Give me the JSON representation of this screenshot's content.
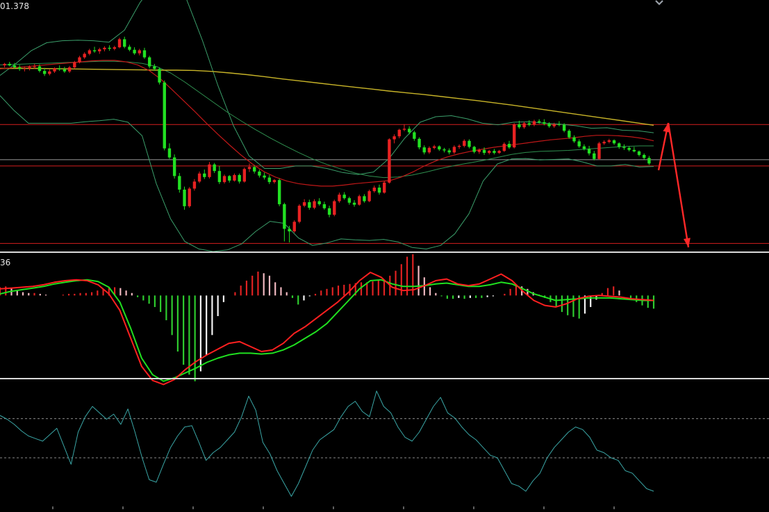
{
  "price_label": "01.378",
  "macd_label": "36",
  "colors": {
    "background": "#000000",
    "bull": "#e82222",
    "bear": "#22e022",
    "level_line": "#d41e1e",
    "gray_line": "#9a9a9a",
    "ma_red": "#c01818",
    "ma_yellow": "#c8b428",
    "ma_green": "#2f8f4f",
    "band": "#3b9f6b",
    "arrow": "#ff2828",
    "macd_fast": "#ff2020",
    "macd_slow": "#20e020",
    "osc_line": "#3aa6a6"
  },
  "chart_data": [
    {
      "type": "candlestick",
      "panel": "price",
      "ylim": [
        0,
        100
      ],
      "up_color": "bull",
      "down_color": "bear",
      "ohlc": [
        [
          74.0,
          75.0,
          73.2,
          74.6
        ],
        [
          74.6,
          75.4,
          73.6,
          74.0
        ],
        [
          74.0,
          75.0,
          72.6,
          73.2
        ],
        [
          73.2,
          74.2,
          71.8,
          72.6
        ],
        [
          72.6,
          73.6,
          71.6,
          72.8
        ],
        [
          72.8,
          74.0,
          72.0,
          73.4
        ],
        [
          73.4,
          74.6,
          72.6,
          73.6
        ],
        [
          73.6,
          74.4,
          71.2,
          71.8
        ],
        [
          71.8,
          73.0,
          69.8,
          70.6
        ],
        [
          70.6,
          72.4,
          70.0,
          71.6
        ],
        [
          71.6,
          73.2,
          71.0,
          72.8
        ],
        [
          72.8,
          74.0,
          71.8,
          72.4
        ],
        [
          72.4,
          73.4,
          71.0,
          71.6
        ],
        [
          71.6,
          73.8,
          71.0,
          73.2
        ],
        [
          73.2,
          75.8,
          72.6,
          75.2
        ],
        [
          75.2,
          77.8,
          74.8,
          77.2
        ],
        [
          77.2,
          79.2,
          76.6,
          78.6
        ],
        [
          78.6,
          80.6,
          78.0,
          80.0
        ],
        [
          80.0,
          81.4,
          79.0,
          79.6
        ],
        [
          79.6,
          81.0,
          78.6,
          80.4
        ],
        [
          80.4,
          81.6,
          79.6,
          81.0
        ],
        [
          81.0,
          82.0,
          79.8,
          80.6
        ],
        [
          80.6,
          81.8,
          80.0,
          81.2
        ],
        [
          81.2,
          85.0,
          80.8,
          84.4
        ],
        [
          84.4,
          85.4,
          80.8,
          81.4
        ],
        [
          81.4,
          82.2,
          79.6,
          80.2
        ],
        [
          80.2,
          81.2,
          78.2,
          78.8
        ],
        [
          78.8,
          80.6,
          78.0,
          80.0
        ],
        [
          80.0,
          81.0,
          76.6,
          77.2
        ],
        [
          77.2,
          77.8,
          72.8,
          73.6
        ],
        [
          73.6,
          74.6,
          71.8,
          72.6
        ],
        [
          72.6,
          73.2,
          66.4,
          67.2
        ],
        [
          67.2,
          68.0,
          40.2,
          41.0
        ],
        [
          41.0,
          43.0,
          36.8,
          37.4
        ],
        [
          37.4,
          38.6,
          29.0,
          30.0
        ],
        [
          30.0,
          31.2,
          23.4,
          24.6
        ],
        [
          24.6,
          25.8,
          16.6,
          18.0
        ],
        [
          18.0,
          25.6,
          17.4,
          25.0
        ],
        [
          25.0,
          28.8,
          24.2,
          27.8
        ],
        [
          27.8,
          31.8,
          27.2,
          31.0
        ],
        [
          31.0,
          32.6,
          28.8,
          29.6
        ],
        [
          29.6,
          35.6,
          29.0,
          34.6
        ],
        [
          34.6,
          35.2,
          31.2,
          32.0
        ],
        [
          32.0,
          34.0,
          26.8,
          27.6
        ],
        [
          27.6,
          30.6,
          27.0,
          30.0
        ],
        [
          30.0,
          30.4,
          27.4,
          28.2
        ],
        [
          28.2,
          31.0,
          27.8,
          30.4
        ],
        [
          30.4,
          31.0,
          27.0,
          27.8
        ],
        [
          27.8,
          33.4,
          27.4,
          32.8
        ],
        [
          32.8,
          35.0,
          31.6,
          33.6
        ],
        [
          33.6,
          34.2,
          31.0,
          31.8
        ],
        [
          31.8,
          32.6,
          29.4,
          30.2
        ],
        [
          30.2,
          31.4,
          28.6,
          29.4
        ],
        [
          29.4,
          30.4,
          26.8,
          27.6
        ],
        [
          27.6,
          28.8,
          27.0,
          28.4
        ],
        [
          28.4,
          29.0,
          18.0,
          18.8
        ],
        [
          18.8,
          19.4,
          4.0,
          9.0
        ],
        [
          9.0,
          10.2,
          3.6,
          8.0
        ],
        [
          8.0,
          12.4,
          7.4,
          11.8
        ],
        [
          11.8,
          18.8,
          11.2,
          18.2
        ],
        [
          18.2,
          20.8,
          17.6,
          19.6
        ],
        [
          19.6,
          20.6,
          16.6,
          17.4
        ],
        [
          17.4,
          20.8,
          16.8,
          20.0
        ],
        [
          20.0,
          21.2,
          18.2,
          18.8
        ],
        [
          18.8,
          19.8,
          16.6,
          17.2
        ],
        [
          17.2,
          18.2,
          13.6,
          14.6
        ],
        [
          14.6,
          20.6,
          14.0,
          20.0
        ],
        [
          20.0,
          23.4,
          19.4,
          22.6
        ],
        [
          22.6,
          23.6,
          20.6,
          21.2
        ],
        [
          21.2,
          21.8,
          18.6,
          19.4
        ],
        [
          19.4,
          20.4,
          17.8,
          18.6
        ],
        [
          18.6,
          22.6,
          18.2,
          22.0
        ],
        [
          22.0,
          22.8,
          19.4,
          20.0
        ],
        [
          20.0,
          24.6,
          19.6,
          24.0
        ],
        [
          24.0,
          26.2,
          23.4,
          25.4
        ],
        [
          25.4,
          26.6,
          22.6,
          23.4
        ],
        [
          23.4,
          28.0,
          23.0,
          27.4
        ],
        [
          27.4,
          45.0,
          27.0,
          44.6
        ],
        [
          44.6,
          46.6,
          43.0,
          45.8
        ],
        [
          45.8,
          48.8,
          45.0,
          48.4
        ],
        [
          48.4,
          50.6,
          47.8,
          48.8
        ],
        [
          48.8,
          49.8,
          46.6,
          47.4
        ],
        [
          47.4,
          48.0,
          44.0,
          44.8
        ],
        [
          44.8,
          45.4,
          40.6,
          41.4
        ],
        [
          41.4,
          42.2,
          38.6,
          39.4
        ],
        [
          39.4,
          41.8,
          38.8,
          41.2
        ],
        [
          41.2,
          42.4,
          40.6,
          41.8
        ],
        [
          41.8,
          42.2,
          40.0,
          40.6
        ],
        [
          40.6,
          41.2,
          39.4,
          40.2
        ],
        [
          40.2,
          41.0,
          38.6,
          39.4
        ],
        [
          39.4,
          42.2,
          38.8,
          41.6
        ],
        [
          41.6,
          42.6,
          40.8,
          42.0
        ],
        [
          42.0,
          44.6,
          41.4,
          44.0
        ],
        [
          44.0,
          44.6,
          41.0,
          41.6
        ],
        [
          41.6,
          42.0,
          39.0,
          39.6
        ],
        [
          39.6,
          41.0,
          38.8,
          40.4
        ],
        [
          40.4,
          41.4,
          38.4,
          39.2
        ],
        [
          39.2,
          40.4,
          38.6,
          40.0
        ],
        [
          40.0,
          40.8,
          38.6,
          39.2
        ],
        [
          39.2,
          40.4,
          38.8,
          40.0
        ],
        [
          40.0,
          43.4,
          39.6,
          42.8
        ],
        [
          42.8,
          44.0,
          40.8,
          41.4
        ],
        [
          41.4,
          51.0,
          41.0,
          50.6
        ],
        [
          50.6,
          52.0,
          48.8,
          49.4
        ],
        [
          49.4,
          51.6,
          48.8,
          51.0
        ],
        [
          51.0,
          52.2,
          49.8,
          50.4
        ],
        [
          50.4,
          52.4,
          49.8,
          51.8
        ],
        [
          51.8,
          52.6,
          50.8,
          51.4
        ],
        [
          51.4,
          52.6,
          50.2,
          50.8
        ],
        [
          50.8,
          51.4,
          49.2,
          49.8
        ],
        [
          49.8,
          51.2,
          49.2,
          50.6
        ],
        [
          50.6,
          51.8,
          49.8,
          50.4
        ],
        [
          50.4,
          51.0,
          47.4,
          48.0
        ],
        [
          48.0,
          48.6,
          44.8,
          45.4
        ],
        [
          45.4,
          46.2,
          43.2,
          43.8
        ],
        [
          43.8,
          44.6,
          41.2,
          41.8
        ],
        [
          41.8,
          42.6,
          40.2,
          40.8
        ],
        [
          40.8,
          42.0,
          38.2,
          39.0
        ],
        [
          39.0,
          40.0,
          36.2,
          36.8
        ],
        [
          36.8,
          43.6,
          36.4,
          43.0
        ],
        [
          43.0,
          44.2,
          42.4,
          43.6
        ],
        [
          43.6,
          44.8,
          43.0,
          44.2
        ],
        [
          44.2,
          44.6,
          42.4,
          43.0
        ],
        [
          43.0,
          43.4,
          40.8,
          41.6
        ],
        [
          41.6,
          42.6,
          40.4,
          41.2
        ],
        [
          41.2,
          41.8,
          39.8,
          40.4
        ],
        [
          40.4,
          41.6,
          39.4,
          39.8
        ],
        [
          39.8,
          40.2,
          37.8,
          38.4
        ],
        [
          38.4,
          39.0,
          36.6,
          37.2
        ],
        [
          37.2,
          38.0,
          34.4,
          35.0
        ]
      ],
      "ma_red": [
        72.6,
        73.0,
        73.4,
        73.8,
        74.2,
        74.6,
        75.0,
        75.4,
        75.8,
        76.0,
        76.0,
        75.4,
        74.2,
        72.0,
        68.6,
        64.4,
        60.0,
        55.6,
        51.0,
        46.6,
        42.4,
        38.4,
        34.8,
        31.8,
        29.6,
        28.0,
        27.0,
        26.4,
        26.0,
        26.0,
        26.4,
        27.0,
        27.4,
        27.8,
        28.2,
        29.6,
        31.6,
        34.0,
        36.0,
        37.6,
        38.8,
        39.8,
        40.6,
        41.4,
        42.0,
        42.6,
        43.2,
        43.8,
        44.4,
        44.8,
        45.2,
        45.8,
        46.2,
        46.2,
        46.0,
        45.6,
        45.0,
        44.0
      ],
      "ma_yellow": [
        72.8,
        72.8,
        72.8,
        72.7,
        72.6,
        72.5,
        72.4,
        72.3,
        72.2,
        72.1,
        72.1,
        72.0,
        71.6,
        71.0,
        70.3,
        69.5,
        68.6,
        67.8,
        67.0,
        66.2,
        65.4,
        64.6,
        63.8,
        63.1,
        62.4,
        61.6,
        60.8,
        60.0,
        59.1,
        58.2,
        57.2,
        56.2,
        55.2,
        54.2,
        53.2,
        52.2,
        51.2,
        50.2
      ],
      "ma_green": [
        74.2,
        74.4,
        74.6,
        74.8,
        75.0,
        75.2,
        75.4,
        75.6,
        75.6,
        75.4,
        74.8,
        73.6,
        71.0,
        67.4,
        63.4,
        59.4,
        55.4,
        51.8,
        48.4,
        45.2,
        42.2,
        39.4,
        36.8,
        34.6,
        32.8,
        31.2,
        30.0,
        29.4,
        29.6,
        30.4,
        31.6,
        33.0,
        34.2,
        35.2,
        36.2,
        37.4,
        38.6,
        39.4,
        39.8,
        40.0,
        40.2,
        40.6,
        41.0,
        41.4,
        41.8,
        42.0,
        42.0
      ],
      "band_upper": [
        70.0,
        74.6,
        79.8,
        83.0,
        83.8,
        84.0,
        83.8,
        83.2,
        88.0,
        99.0,
        107.0,
        111.0,
        100.0,
        84.0,
        66.0,
        50.0,
        38.0,
        33.0,
        33.0,
        34.0,
        34.0,
        33.0,
        31.4,
        30.6,
        31.6,
        37.0,
        45.0,
        51.4,
        53.6,
        54.0,
        52.8,
        51.0,
        50.4,
        51.4,
        51.6,
        51.0,
        50.6,
        50.0,
        49.0,
        49.2,
        48.2,
        48.0,
        47.2
      ],
      "band_lower": [
        62.0,
        56.0,
        51.0,
        51.0,
        51.0,
        51.0,
        51.6,
        52.0,
        52.6,
        51.4,
        46.0,
        27.0,
        13.0,
        4.0,
        1.0,
        0.0,
        0.6,
        3.0,
        8.0,
        12.0,
        11.2,
        5.4,
        2.4,
        3.4,
        5.0,
        4.6,
        4.4,
        4.8,
        3.8,
        1.6,
        1.0,
        2.4,
        7.0,
        15.0,
        28.0,
        34.8,
        36.8,
        37.0,
        36.4,
        36.6,
        36.8,
        35.6,
        34.0,
        34.0,
        34.6,
        33.6,
        33.8
      ],
      "levels": [
        50.5,
        36.5,
        34.0,
        3.2
      ],
      "annotations": [
        {
          "type": "arrow",
          "dir": "up",
          "from": [
            948,
            245
          ],
          "to": [
            962,
            177
          ]
        },
        {
          "type": "arrow",
          "dir": "down",
          "from": [
            962,
            177
          ],
          "to": [
            991,
            356
          ]
        }
      ]
    },
    {
      "type": "macd",
      "panel": "indicator",
      "ylim": [
        -100,
        50
      ],
      "hist": [
        10,
        11,
        9,
        6,
        4,
        3,
        3,
        2,
        1,
        0,
        0,
        1,
        2,
        2,
        3,
        3,
        4,
        6,
        8,
        9,
        10,
        9,
        6,
        3,
        -2,
        -6,
        -10,
        -14,
        -20,
        -30,
        -48,
        -68,
        -84,
        -96,
        -104,
        -92,
        -72,
        -48,
        -25,
        -8,
        0,
        4,
        12,
        18,
        24,
        29,
        27,
        24,
        16,
        10,
        4,
        -3,
        -11,
        -6,
        -1,
        2,
        6,
        8,
        10,
        12,
        13,
        14,
        15,
        16,
        16,
        17,
        18,
        19,
        24,
        30,
        38,
        47,
        50,
        36,
        22,
        10,
        3,
        -1,
        -4,
        -4,
        -3,
        -4,
        -3,
        -3,
        -3,
        -2,
        -1,
        0,
        2,
        8,
        13,
        11,
        8,
        4,
        1,
        -3,
        -8,
        -14,
        -20,
        -24,
        -26,
        -28,
        -22,
        -14,
        -5,
        3,
        9,
        11,
        6,
        0,
        -4,
        -8,
        -12,
        -15,
        -16
      ],
      "fast": [
        8,
        9,
        10,
        11,
        13,
        16,
        18,
        19,
        18,
        13,
        2,
        -18,
        -52,
        -86,
        -103,
        -108,
        -102,
        -90,
        -80,
        -72,
        -65,
        -58,
        -56,
        -62,
        -68,
        -66,
        -58,
        -46,
        -38,
        -28,
        -18,
        -8,
        4,
        18,
        28,
        22,
        10,
        6,
        7,
        12,
        18,
        20,
        14,
        12,
        14,
        20,
        26,
        18,
        5,
        -6,
        -12,
        -14,
        -10,
        -4,
        -1,
        0,
        -1,
        -2,
        -4,
        -5,
        -6
      ],
      "slow": [
        2,
        5,
        7,
        9,
        11,
        14,
        16,
        18,
        19,
        17,
        10,
        -8,
        -40,
        -76,
        -96,
        -104,
        -100,
        -94,
        -88,
        -81,
        -76,
        -72,
        -70,
        -70,
        -71,
        -70,
        -66,
        -60,
        -52,
        -44,
        -34,
        -20,
        -6,
        8,
        18,
        19,
        14,
        11,
        11,
        12,
        14,
        15,
        13,
        11,
        11,
        13,
        16,
        14,
        8,
        2,
        -2,
        -6,
        -5,
        -4,
        -3,
        -3,
        -3,
        -4,
        -5,
        -6,
        -6
      ]
    },
    {
      "type": "line",
      "panel": "oscillator",
      "ylim": [
        0,
        100
      ],
      "ref_lines": [
        70.5,
        40.0
      ],
      "values": [
        73,
        70,
        66,
        61,
        57,
        55,
        53,
        58,
        63,
        49,
        35,
        60,
        72,
        80,
        75,
        70,
        74,
        66,
        78,
        60,
        40,
        23,
        21,
        35,
        48,
        57,
        64,
        65,
        52,
        38,
        44,
        48,
        54,
        60,
        72,
        88,
        77,
        52,
        43,
        30,
        20,
        10,
        20,
        33,
        46,
        54,
        58,
        62,
        72,
        80,
        84,
        76,
        72,
        92,
        80,
        75,
        64,
        56,
        53,
        60,
        70,
        80,
        87,
        75,
        71,
        64,
        58,
        54,
        48,
        42,
        40,
        30,
        20,
        18,
        14,
        22,
        28,
        40,
        48,
        54,
        60,
        64,
        62,
        56,
        46,
        44,
        40,
        38,
        30,
        28,
        22,
        16,
        14
      ]
    }
  ]
}
